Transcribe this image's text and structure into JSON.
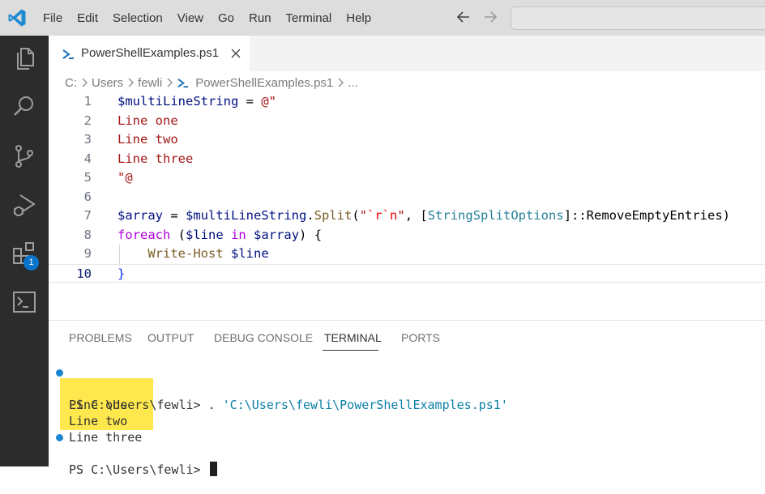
{
  "menu": [
    "File",
    "Edit",
    "Selection",
    "View",
    "Go",
    "Run",
    "Terminal",
    "Help"
  ],
  "activity_bar": {
    "icons": [
      "explorer-icon",
      "search-icon",
      "source-control-icon",
      "run-debug-icon",
      "extensions-icon",
      "remote-terminal-icon"
    ],
    "extensions_badge": "1"
  },
  "tab": {
    "label": "PowerShellExamples.ps1",
    "icon": "powershell-icon"
  },
  "breadcrumb": [
    "C:",
    "Users",
    "fewli",
    "PowerShellExamples.ps1",
    "..."
  ],
  "editor": {
    "lines": [
      {
        "num": "1",
        "tokens": [
          {
            "t": "$multiLineString",
            "c": "var"
          },
          {
            "t": " = ",
            "c": "plain"
          },
          {
            "t": "@\"",
            "c": "str"
          }
        ]
      },
      {
        "num": "2",
        "tokens": [
          {
            "t": "Line one",
            "c": "str"
          }
        ]
      },
      {
        "num": "3",
        "tokens": [
          {
            "t": "Line two",
            "c": "str"
          }
        ]
      },
      {
        "num": "4",
        "tokens": [
          {
            "t": "Line three",
            "c": "str"
          }
        ]
      },
      {
        "num": "5",
        "tokens": [
          {
            "t": "\"@",
            "c": "str"
          }
        ]
      },
      {
        "num": "6",
        "tokens": []
      },
      {
        "num": "7",
        "tokens": [
          {
            "t": "$array",
            "c": "var"
          },
          {
            "t": " = ",
            "c": "plain"
          },
          {
            "t": "$multiLineString",
            "c": "var"
          },
          {
            "t": ".",
            "c": "plain"
          },
          {
            "t": "Split",
            "c": "fn"
          },
          {
            "t": "(",
            "c": "plain"
          },
          {
            "t": "\"",
            "c": "str"
          },
          {
            "t": "`r`n",
            "c": "esc"
          },
          {
            "t": "\"",
            "c": "str"
          },
          {
            "t": ", ",
            "c": "plain"
          },
          {
            "t": "[",
            "c": "plain"
          },
          {
            "t": "StringSplitOptions",
            "c": "type"
          },
          {
            "t": "]::RemoveEmptyEntries)",
            "c": "plain"
          }
        ]
      },
      {
        "num": "8",
        "tokens": [
          {
            "t": "foreach",
            "c": "kw"
          },
          {
            "t": " (",
            "c": "plain"
          },
          {
            "t": "$line",
            "c": "var"
          },
          {
            "t": " ",
            "c": "plain"
          },
          {
            "t": "in",
            "c": "kw"
          },
          {
            "t": " ",
            "c": "plain"
          },
          {
            "t": "$array",
            "c": "var"
          },
          {
            "t": ") {",
            "c": "plain"
          }
        ]
      },
      {
        "num": "9",
        "tokens": [
          {
            "t": "    ",
            "c": "plain"
          },
          {
            "t": "Write-Host",
            "c": "fn"
          },
          {
            "t": " ",
            "c": "plain"
          },
          {
            "t": "$line",
            "c": "var"
          }
        ]
      },
      {
        "num": "10",
        "tokens": [
          {
            "t": "}",
            "c": "brace"
          }
        ]
      }
    ]
  },
  "panel": {
    "tabs": [
      "PROBLEMS",
      "OUTPUT",
      "DEBUG CONSOLE",
      "TERMINAL",
      "PORTS"
    ],
    "active_tab": "TERMINAL"
  },
  "terminal": {
    "prompt": "PS C:\\Users\\fewli>",
    "command_prefix": " . ",
    "command_path": "'C:\\Users\\fewli\\PowerShellExamples.ps1'",
    "output": [
      "Line one",
      "Line two",
      "Line three"
    ],
    "prompt2": "PS C:\\Users\\fewli>"
  },
  "colors": {
    "accent": "#0a74cc",
    "highlight": "#ffe84d",
    "activity_bar": "#2c2c2c"
  }
}
